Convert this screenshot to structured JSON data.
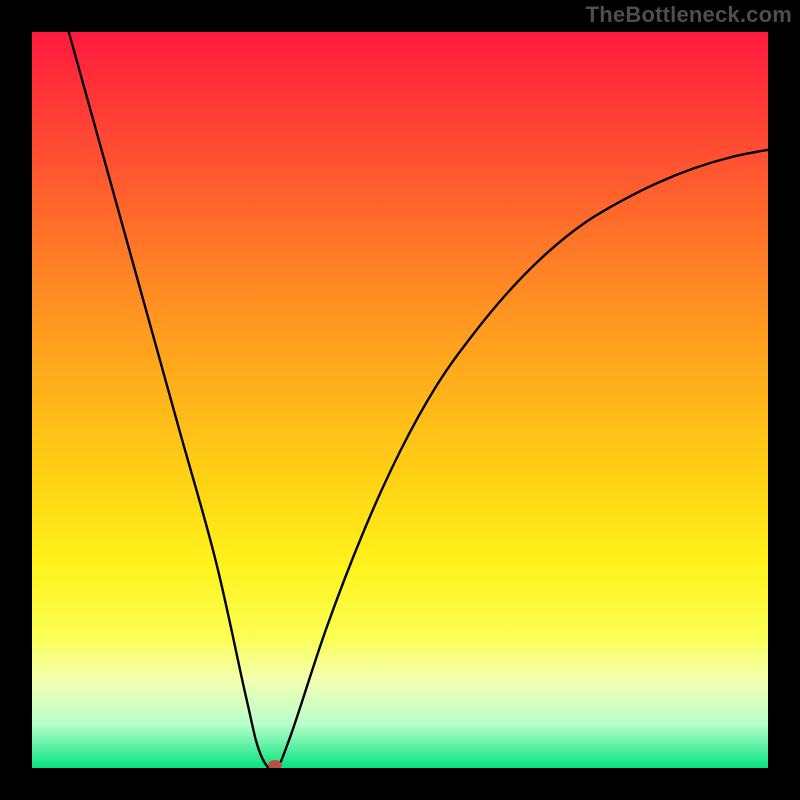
{
  "watermark": "TheBottleneck.com",
  "colors": {
    "frame": "#000000",
    "curve": "#000000",
    "marker": "#bb4f41",
    "gradient_stops": [
      {
        "offset": 0.0,
        "color": "#ff1a3e"
      },
      {
        "offset": 0.2,
        "color": "#ff5a2f"
      },
      {
        "offset": 0.4,
        "color": "#ff9a1f"
      },
      {
        "offset": 0.6,
        "color": "#ffd014"
      },
      {
        "offset": 0.72,
        "color": "#fff21a"
      },
      {
        "offset": 0.82,
        "color": "#fbff52"
      },
      {
        "offset": 0.88,
        "color": "#f3ffb0"
      },
      {
        "offset": 0.94,
        "color": "#b8ffcb"
      },
      {
        "offset": 1.0,
        "color": "#07e27f"
      }
    ]
  },
  "chart_data": {
    "type": "line",
    "title": "",
    "xlabel": "",
    "ylabel": "",
    "xlim": [
      0,
      100
    ],
    "ylim": [
      0,
      100
    ],
    "grid": false,
    "legend": false,
    "series": [
      {
        "name": "bottleneck_curve",
        "x_optimum": 33,
        "marker": {
          "x": 33,
          "y": 0
        },
        "points": [
          {
            "x": 5,
            "y": 100
          },
          {
            "x": 10,
            "y": 82
          },
          {
            "x": 15,
            "y": 64
          },
          {
            "x": 20,
            "y": 46
          },
          {
            "x": 25,
            "y": 28
          },
          {
            "x": 29,
            "y": 10
          },
          {
            "x": 31,
            "y": 2
          },
          {
            "x": 33,
            "y": 0
          },
          {
            "x": 35,
            "y": 4
          },
          {
            "x": 40,
            "y": 19
          },
          {
            "x": 45,
            "y": 32
          },
          {
            "x": 50,
            "y": 43
          },
          {
            "x": 55,
            "y": 52
          },
          {
            "x": 60,
            "y": 59
          },
          {
            "x": 65,
            "y": 65
          },
          {
            "x": 70,
            "y": 70
          },
          {
            "x": 75,
            "y": 74
          },
          {
            "x": 80,
            "y": 77
          },
          {
            "x": 85,
            "y": 79.5
          },
          {
            "x": 90,
            "y": 81.5
          },
          {
            "x": 95,
            "y": 83
          },
          {
            "x": 100,
            "y": 84
          }
        ]
      }
    ]
  }
}
